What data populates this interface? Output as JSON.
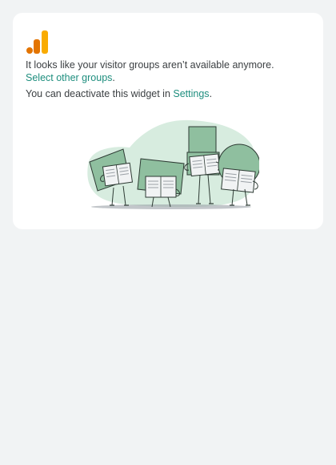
{
  "widget": {
    "message_line": "It looks like your visitor groups aren’t available anymore.",
    "select_link": "Select other groups",
    "select_suffix": ".",
    "deactivate_prefix": "You can deactivate this widget in ",
    "settings_link": "Settings",
    "settings_suffix": "."
  },
  "icons": {
    "logo": "analytics-logo-icon",
    "illustration": "people-reading-newspapers-illustration"
  },
  "colors": {
    "logo_orange": "#f9ab00",
    "logo_dark_orange": "#e37400",
    "link": "#1e8e7e",
    "illustration_green": "#8fbf9f",
    "illustration_bg": "#d7ecdf"
  }
}
